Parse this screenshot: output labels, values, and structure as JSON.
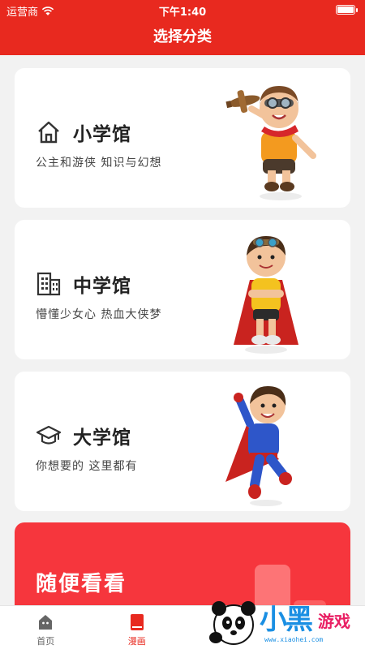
{
  "status_bar": {
    "carrier": "运营商",
    "time": "下午1:40",
    "battery_level": 1.0
  },
  "nav": {
    "title": "选择分类"
  },
  "categories": [
    {
      "title": "小学馆",
      "subtitle": "公主和游侠 知识与幻想",
      "icon": "home-outline-icon"
    },
    {
      "title": "中学馆",
      "subtitle": "懵懂少女心 热血大侠梦",
      "icon": "buildings-icon"
    },
    {
      "title": "大学馆",
      "subtitle": "你想要的 这里都有",
      "icon": "graduation-cap-icon"
    }
  ],
  "random": {
    "title": "随便看看"
  },
  "tabs": [
    {
      "label": "首页",
      "icon": "home-tab-icon",
      "active": false
    },
    {
      "label": "漫画",
      "icon": "book-tab-icon",
      "active": true
    },
    {
      "label": "",
      "icon": "tab-icon",
      "active": false
    }
  ],
  "watermark": {
    "brand": "小黑",
    "brand2": "游戏",
    "url": "www.xiaohei.com"
  },
  "colors": {
    "primary": "#e8291f",
    "random_card": "#f6363d",
    "page_bg": "#f2f2f2"
  }
}
